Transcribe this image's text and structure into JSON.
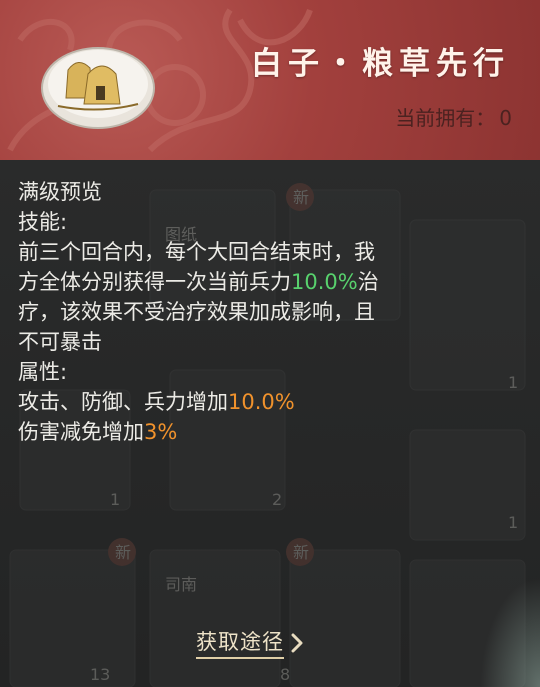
{
  "header": {
    "title": "白子・粮草先行",
    "owned_label": "当前拥有：",
    "owned_count": "0",
    "item_icon": "haystack-token-icon"
  },
  "description": {
    "section_title": "满级预览",
    "skill_label": "技能:",
    "skill_line1": "前三个回合内，每个大回合结束时，我",
    "skill_line2_pre": "方全体分别获得一次当前兵力",
    "skill_line2_value": "10.0%",
    "skill_line2_post": "治",
    "skill_line3": "疗，该效果不受治疗效果加成影响，且",
    "skill_line4": "不可暴击",
    "attr_label": "属性:",
    "attr_line1_pre": "攻击、防御、兵力增加",
    "attr_line1_value": "10.0%",
    "attr_line2_pre": "伤害减免增加",
    "attr_line2_value": "3%"
  },
  "background_items": {
    "badges": [
      "新",
      "新",
      "新"
    ],
    "labels": [
      "图纸",
      "司南"
    ],
    "counts": [
      "1",
      "1",
      "2",
      "1",
      "13",
      "8"
    ]
  },
  "actions": {
    "acquire_label": "获取途径",
    "acquire_icon": "chevron-right-icon"
  },
  "colors": {
    "header_red": "#a2403d",
    "body_dark": "#262727",
    "highlight_green": "#58d16d",
    "highlight_orange": "#f0922c"
  }
}
